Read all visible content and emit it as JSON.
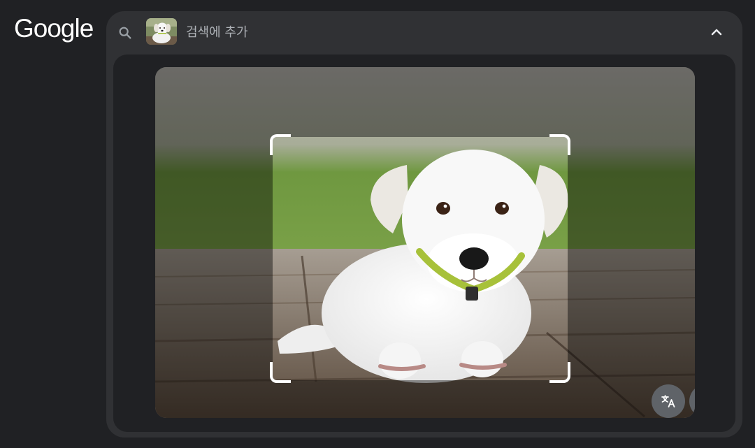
{
  "brand": {
    "logo_text": "Google",
    "logo_color": "#ffffff"
  },
  "search": {
    "placeholder": "검색에 추가",
    "value": "",
    "thumbnail": "puppy-thumbnail-image"
  },
  "icons": {
    "search": "search-icon",
    "collapse": "chevron-up-icon",
    "translate": "translate-icon",
    "fullscreen": "fullscreen-icon",
    "crop_handles": "crop-corner-icon"
  },
  "colors": {
    "page_background": "#202124",
    "panel_background": "#303134",
    "button_background": "#5f6368",
    "text_muted": "#aeb2b7",
    "crop_handle": "#ffffff"
  }
}
